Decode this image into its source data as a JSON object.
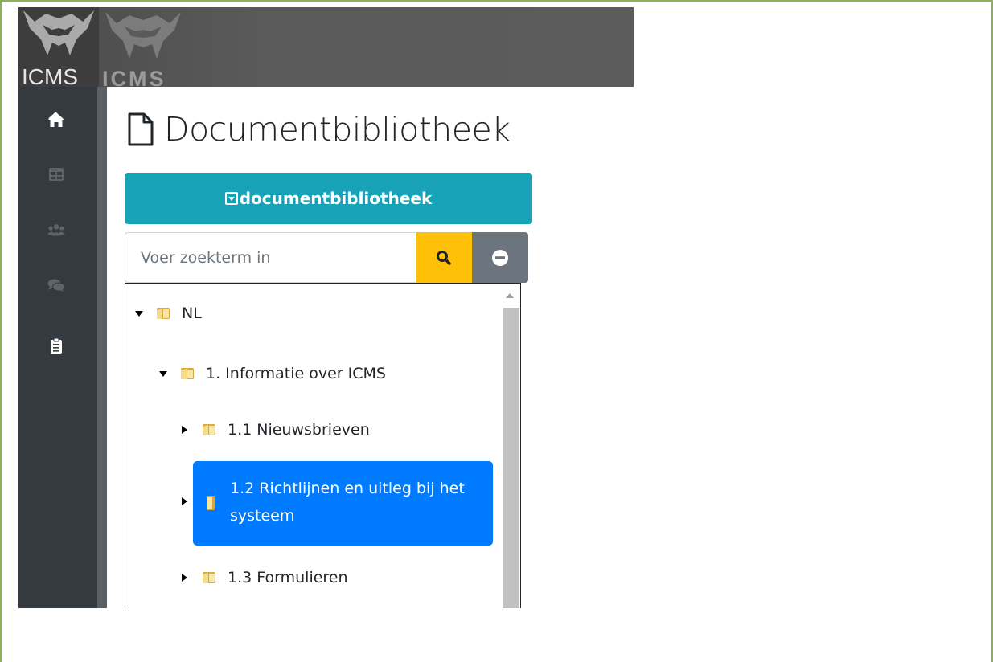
{
  "brand": {
    "logo_text_left": "ICMS",
    "logo_text_right": "ICMS"
  },
  "sidebar": {
    "items": [
      {
        "icon": "home-icon"
      },
      {
        "icon": "grid-icon"
      },
      {
        "icon": "users-icon"
      },
      {
        "icon": "chat-icon"
      },
      {
        "icon": "clipboard-icon"
      }
    ]
  },
  "page": {
    "title": "Documentbibliotheek"
  },
  "library_button": {
    "label": "documentbibliotheek"
  },
  "search": {
    "placeholder": "Voer zoekterm in",
    "value": ""
  },
  "tree": {
    "nodes": [
      {
        "label": "NL",
        "expanded": true
      },
      {
        "label": "1. Informatie over ICMS",
        "expanded": true
      },
      {
        "label": "1.1 Nieuwsbrieven",
        "expanded": false
      },
      {
        "label": "1.2 Richtlijnen en uitleg bij het systeem",
        "expanded": false,
        "selected": true
      },
      {
        "label": "1.3 Formulieren",
        "expanded": false
      }
    ]
  },
  "colors": {
    "accent_teal": "#17a2b8",
    "search_yellow": "#ffc107",
    "clear_gray": "#6c757d",
    "selected_blue": "#007bff",
    "sidebar_dark": "#343a40",
    "frame_green": "#8db255"
  }
}
